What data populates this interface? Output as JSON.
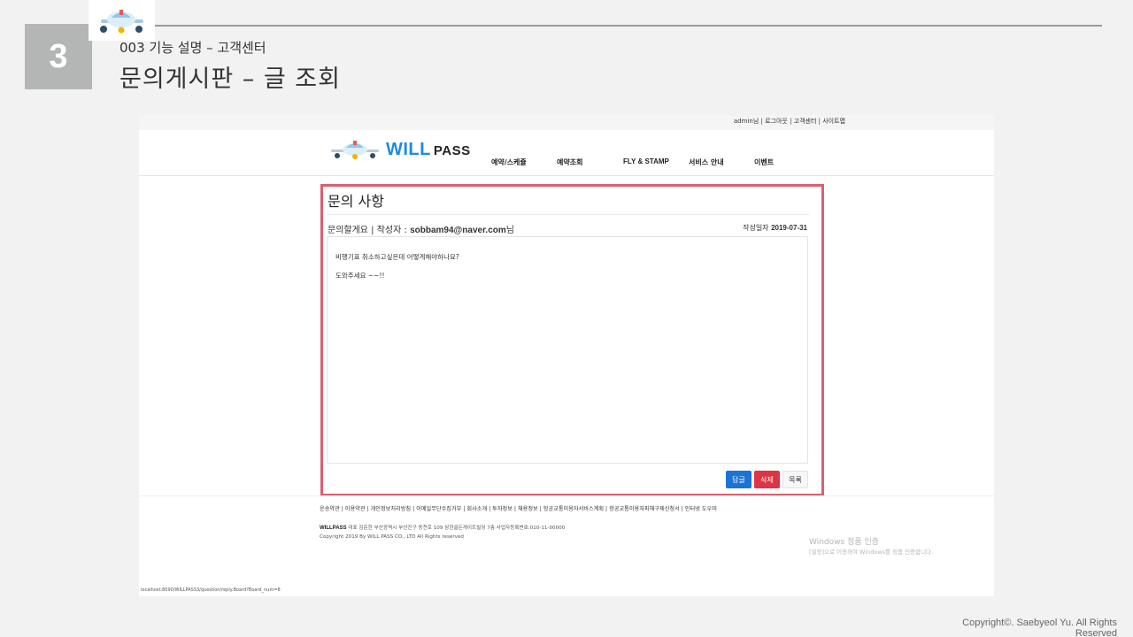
{
  "slide": {
    "number": "3",
    "subtitle": "003 기능 설명 – 고객센터",
    "title": "문의게시판 – 글 조회",
    "copyright_line1": "Copyright©. Saebyeol Yu. All Rights",
    "copyright_line2": "Reserved"
  },
  "browser": {
    "util_links": {
      "admin": "admin님",
      "logout": "로그아웃",
      "support": "고객센터",
      "sitemap": "사이트맵",
      "separator": " | "
    },
    "brand": {
      "will": "WILL",
      "pass": "PASS"
    },
    "nav": [
      "예약/스케쥴",
      "예약조회",
      "FLY & STAMP",
      "서비스 안내",
      "이벤트"
    ],
    "panel": {
      "heading": "문의 사항",
      "post_title": "문의할게요",
      "separator": " | ",
      "author_label": "작성자 : ",
      "author": "sobbam94@naver.com",
      "author_suffix": "님",
      "date_label": "작성일자 ",
      "date": "2019-07-31",
      "content": [
        "비행기표 취소하고싶은데 어떻게해야하나요?",
        "도와주세요 ~~!!"
      ],
      "buttons": {
        "reply": "답글",
        "delete": "삭제",
        "list": "목록"
      }
    },
    "footer": {
      "links": "운송약관 | 이용약관 | 개인정보처리방침 | 이메일무단수집거부 | 회사소개 | 투자정보 | 채용정보 | 항공교통이용자서비스계획 | 항공교통이용자피해구제신청서 | 인터넷 도우미",
      "company_name": "WILLPASS",
      "company_info": " 대표 김준한 부산광역시 부산진구 동천로 109 삼한골든게이트빌딩 7층 사업자등록번호:010-11-00000",
      "copyright": "Copyright 2019 By WILL PASS CO., LTD All Rights reserved"
    },
    "windows_notice": {
      "title": "Windows 정품 인증",
      "subtitle": "[설정]으로 이동하여 Windows를 정품 인증합니다."
    },
    "status_url": "localhost:8090/WILLPASS3/question/reply.Board?Board_num=8"
  },
  "colors": {
    "slide_number_bg": "#b3b6b4",
    "panel_border": "#dc5f72",
    "brand_blue": "#1c8be6",
    "reply_button": "#1b73d6",
    "delete_button": "#dc3545"
  }
}
